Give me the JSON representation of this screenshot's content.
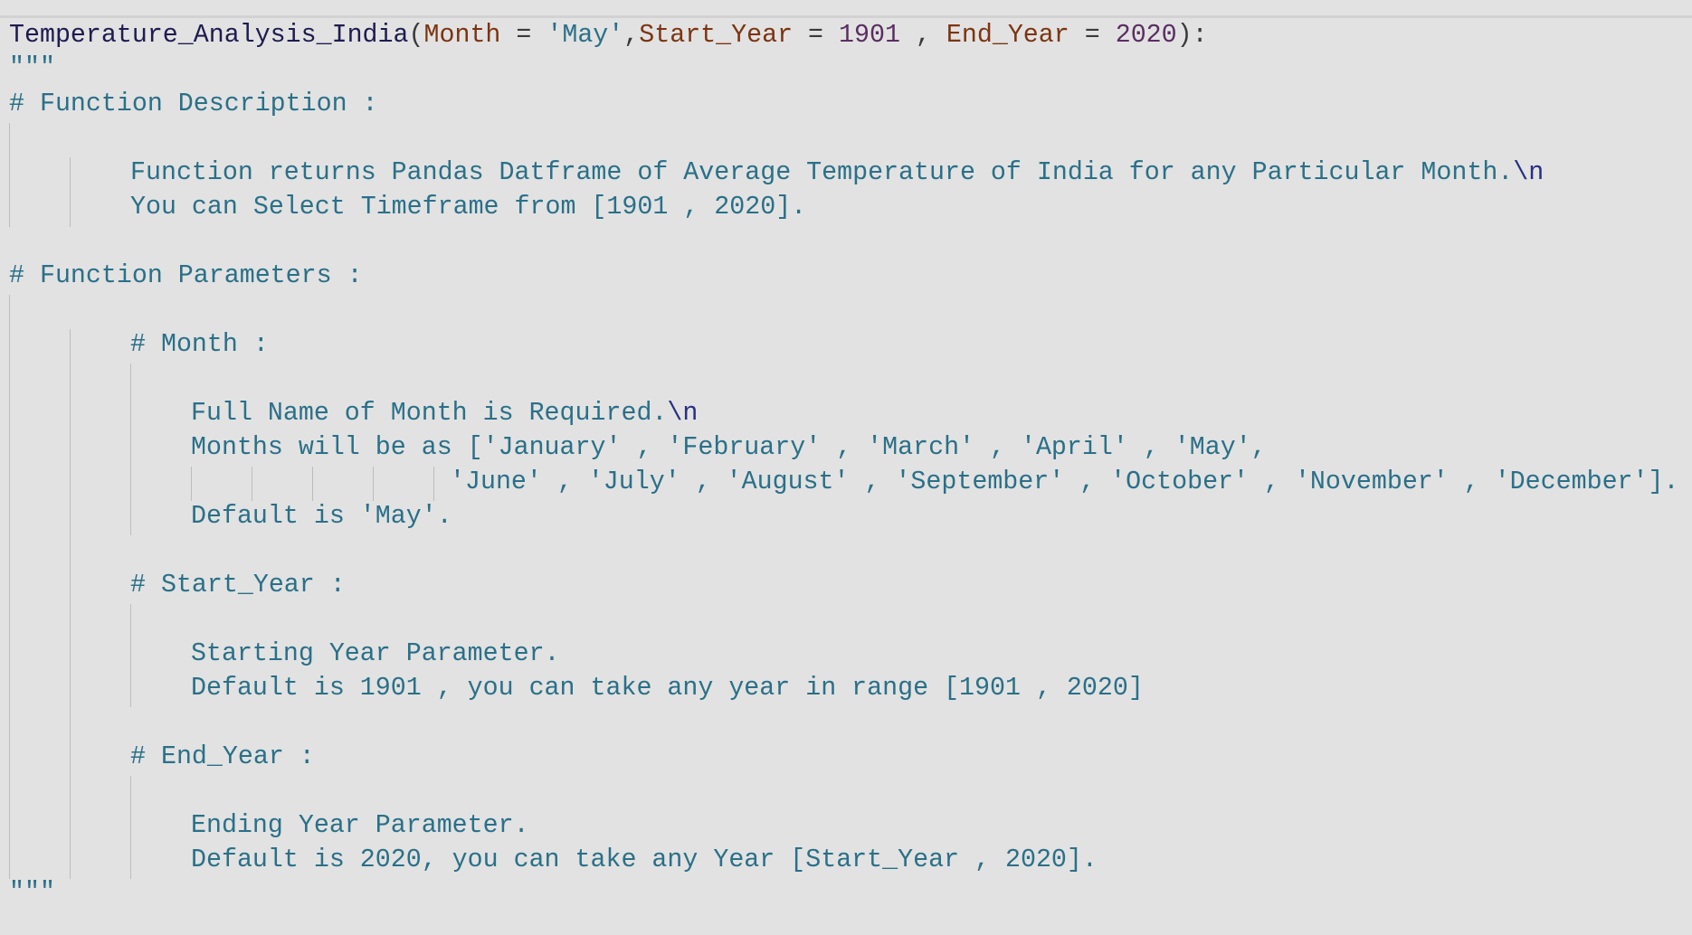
{
  "signature": {
    "function_name": "Temperature_Analysis_India",
    "open_paren": "(",
    "param1_name": "Month",
    "eq1": " = ",
    "param1_default": "'May'",
    "comma1": ",",
    "param2_name": "Start_Year",
    "eq2": " = ",
    "param2_default": "1901",
    "comma2": " , ",
    "param3_name": "End_Year",
    "eq3": " = ",
    "param3_default": "2020",
    "close": "):"
  },
  "docstring": {
    "open_quotes": "\"\"\"",
    "close_quotes": "\"\"\"",
    "description_heading": "# Function Description :",
    "description_line1": "Function returns Pandas Datframe of Average Temperature of India for any Particular Month.",
    "description_line1_escape": "\\n",
    "description_line2": "You can Select Timeframe from [1901 , 2020].",
    "parameters_heading": "# Function Parameters :",
    "month": {
      "heading": "# Month :",
      "line1": "Full Name of Month is Required.",
      "line1_escape": "\\n",
      "line2": "Months will be as ['January' , 'February' , 'March' , 'April' , 'May',",
      "line3": "'June' , 'July' , 'August' , 'September' , 'October' , 'November' , 'December'].",
      "line4": "Default is 'May'."
    },
    "start_year": {
      "heading": "# Start_Year :",
      "line1": "Starting Year Parameter.",
      "line2": "Default is 1901 , you can take any year in range [1901 , 2020]"
    },
    "end_year": {
      "heading": "# End_Year :",
      "line1": "Ending Year Parameter.",
      "line2": "Default is 2020, you can take any Year [Start_Year , 2020]."
    }
  }
}
